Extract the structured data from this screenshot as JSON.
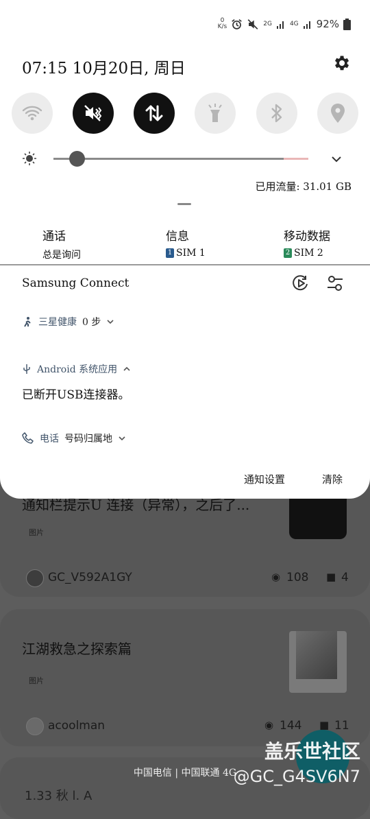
{
  "status_bar": {
    "speed_value": "0",
    "speed_unit": "K/s",
    "net_label_1": "2G",
    "net_label_2": "4G",
    "battery": "92%"
  },
  "header": {
    "datetime": "07:15  10月20日, 周日"
  },
  "quick_settings": [
    {
      "icon": "wifi-icon",
      "active": false
    },
    {
      "icon": "mute-vibrate-icon",
      "active": true
    },
    {
      "icon": "mobile-data-icon",
      "active": true
    },
    {
      "icon": "flashlight-icon",
      "active": false
    },
    {
      "icon": "bluetooth-icon",
      "active": false
    },
    {
      "icon": "location-icon",
      "active": false
    }
  ],
  "brightness": {
    "level": 0.09
  },
  "data_usage": "已用流量: 31.01 GB",
  "sim_settings": [
    {
      "title": "通话",
      "value": "总是询问"
    },
    {
      "title": "信息",
      "badge": "1",
      "value": "SIM 1",
      "badge_color": "#2a5b8e"
    },
    {
      "title": "移动数据",
      "badge": "2",
      "value": "SIM 2",
      "badge_color": "#2a8a5a"
    }
  ],
  "samsung_connect": {
    "title": "Samsung Connect"
  },
  "notifications": [
    {
      "app": "三星健康",
      "detail": "0 步"
    },
    {
      "app": "Android 系统应用",
      "body": "已断开USB连接器。"
    },
    {
      "app": "电话",
      "detail": "号码归属地"
    }
  ],
  "actions": {
    "settings": "通知设置",
    "clear": "清除"
  },
  "background": {
    "card1": {
      "title": "通知栏提示U 连接（异常），之后了...",
      "tag": "图片",
      "author": "GC_V592A1GY",
      "views": "108",
      "replies": "4"
    },
    "card2": {
      "title": "江湖救急之探索篇",
      "tag": "图片",
      "author": "acoolman",
      "views": "144",
      "replies": "11"
    },
    "peek_text": "1.33 秋 l. A",
    "carrier": "中国电信 | 中国联通 4G",
    "watermark_1": "盖乐世社区",
    "watermark_2": "@GC_G4SV6N7"
  }
}
